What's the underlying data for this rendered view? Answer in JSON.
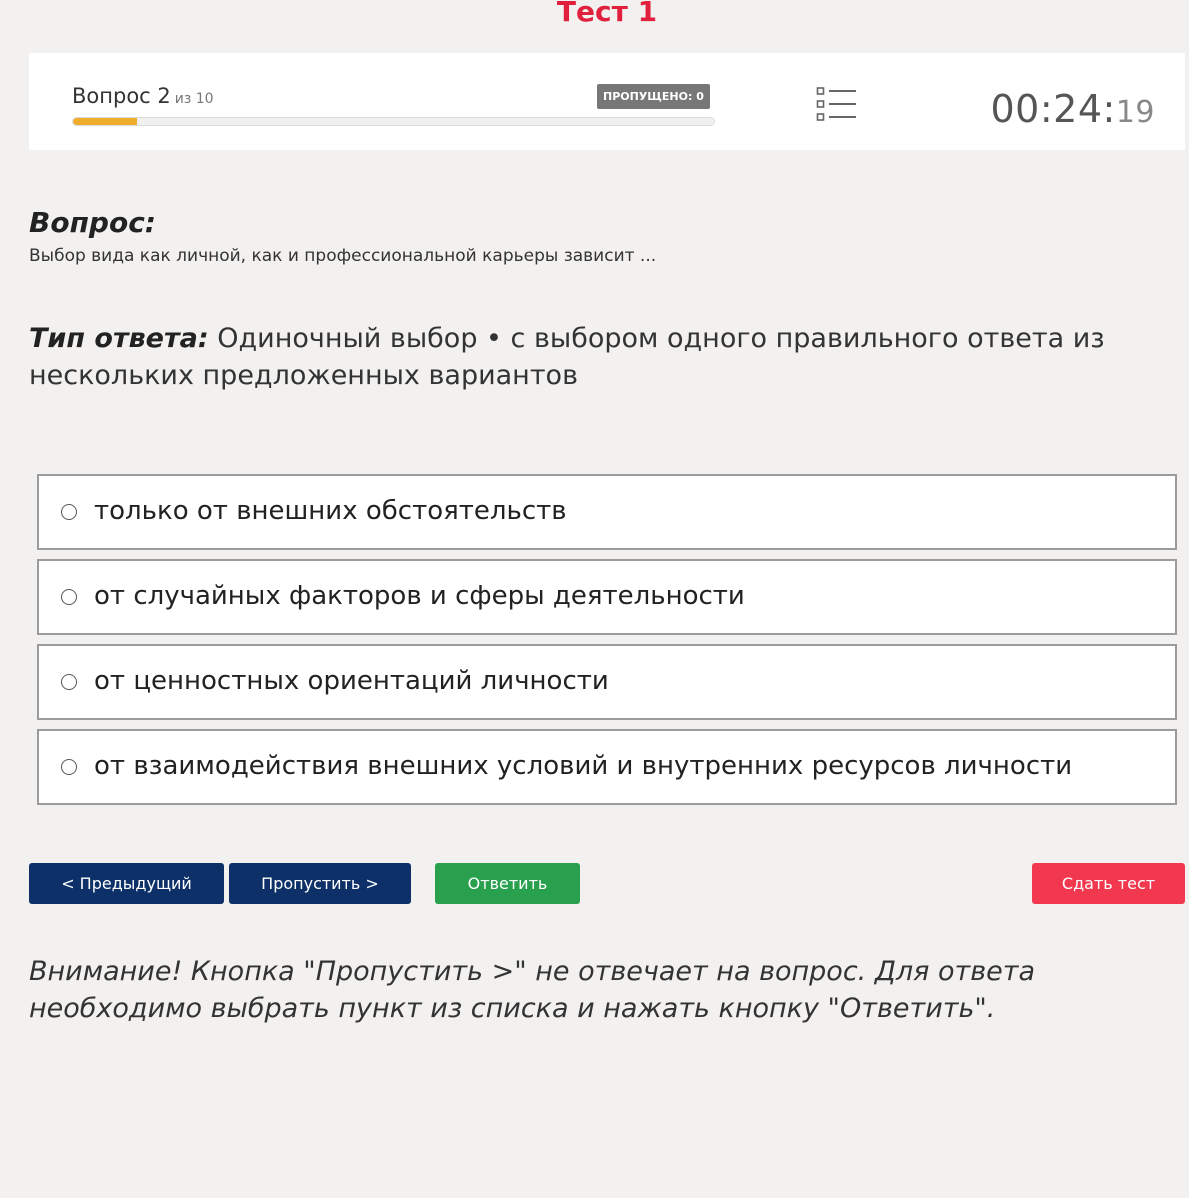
{
  "page": {
    "title": "Тест 1"
  },
  "header": {
    "question_label": "Вопрос 2",
    "question_of": "из 10",
    "skipped_badge": "ПРОПУЩЕНО: 0",
    "progress_fraction": 0.1,
    "timer_main": "00:24:",
    "timer_seconds": "19"
  },
  "question": {
    "heading": "Вопрос:",
    "text": "Выбор вида как личной, как и профессиональной карьеры зависит ..."
  },
  "answer_type": {
    "label": "Тип ответа:",
    "text": " Одиночный выбор • с выбором одного правильного ответа из нескольких предложенных вариантов"
  },
  "options": [
    "только от внешних обстоятельств",
    "от случайных факторов и сферы деятельности",
    "от ценностных ориентаций личности",
    "от взаимодействия внешних условий и внутренних ресурсов личности"
  ],
  "buttons": {
    "prev": "< Предыдущий",
    "skip": "Пропустить >",
    "answer": "Ответить",
    "submit": "Сдать тест"
  },
  "notice": "Внимание! Кнопка \"Пропустить >\" не отвечает на вопрос. Для ответа необходимо выбрать пункт из списка и нажать кнопку \"Ответить\".",
  "colors": {
    "title": "#e0203d",
    "progress": "#f0ad2b",
    "nav_button": "#0d3068",
    "answer_button": "#28a04e",
    "submit_button": "#f2384f"
  },
  "icons": {
    "question_list": "list-checklist-icon",
    "radio": "radio-unchecked-icon"
  }
}
